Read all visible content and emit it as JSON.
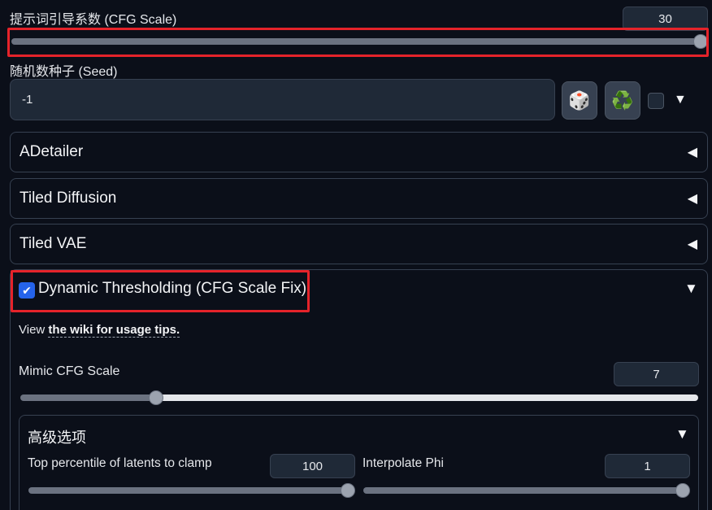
{
  "cfg": {
    "label": "提示词引导系数 (CFG Scale)",
    "value": "30",
    "slider_fraction": 1.0
  },
  "seed": {
    "label": "随机数种子 (Seed)",
    "value": "-1",
    "dice_icon": "🎲",
    "recycle_icon": "♻️",
    "extra_toggle_icon": "▼"
  },
  "accordions": [
    {
      "label": "ADetailer",
      "arrow": "◀"
    },
    {
      "label": "Tiled Diffusion",
      "arrow": "◀"
    },
    {
      "label": "Tiled VAE",
      "arrow": "◀"
    }
  ],
  "dynamic_thresholding": {
    "title": "Dynamic Thresholding (CFG Scale Fix)",
    "checked": true,
    "check_glyph": "✔",
    "arrow": "▼",
    "view_prefix": "View ",
    "wiki_link": "the wiki for usage tips.",
    "mimic": {
      "label": "Mimic CFG Scale",
      "value": "7",
      "slider_fraction": 0.2
    },
    "advanced": {
      "title": "高级选项",
      "arrow": "▼",
      "top_percentile": {
        "label": "Top percentile of latents to clamp",
        "value": "100",
        "slider_fraction": 1.0
      },
      "interpolate_phi": {
        "label": "Interpolate Phi",
        "value": "1",
        "slider_fraction": 1.0
      }
    }
  },
  "colors": {
    "accent_red": "#e5232a",
    "checkbox_blue": "#2563eb",
    "background": "#0b0f19"
  }
}
